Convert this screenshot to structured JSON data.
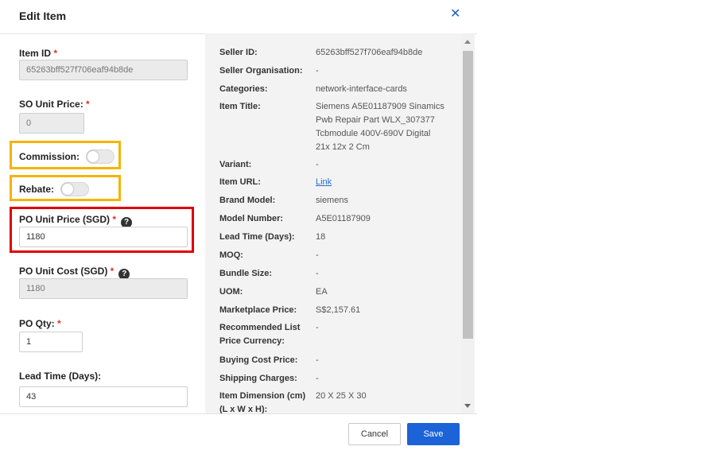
{
  "dialog": {
    "title": "Edit Item"
  },
  "form": {
    "item_id": {
      "label": "Item ID",
      "required_mark": "*",
      "value": "65263bff527f706eaf94b8de"
    },
    "so_unit_price": {
      "label": "SO Unit Price:",
      "required_mark": "*",
      "value": "0"
    },
    "commission": {
      "label": "Commission:",
      "enabled": false
    },
    "rebate": {
      "label": "Rebate:",
      "enabled": false
    },
    "po_unit_price": {
      "label": "PO Unit Price (SGD)",
      "required_mark": "*",
      "help": "?",
      "value": "1180"
    },
    "po_unit_cost": {
      "label": "PO Unit Cost (SGD)",
      "required_mark": "*",
      "help": "?",
      "value": "1180"
    },
    "po_qty": {
      "label": "PO Qty:",
      "required_mark": "*",
      "value": "1"
    },
    "lead_time": {
      "label": "Lead Time (Days):",
      "value": "43"
    }
  },
  "details": [
    {
      "label": "Seller ID:",
      "value": "65263bff527f706eaf94b8de"
    },
    {
      "label": "Seller Organisation:",
      "value": "-"
    },
    {
      "label": "Categories:",
      "value": "network-interface-cards"
    },
    {
      "label": "Item Title:",
      "value": "Siemens A5E01187909 Sinamics Pwb Repair Part WLX_307377 Tcbmodule 400V-690V Digital 21x 12x 2 Cm"
    },
    {
      "label": "Variant:",
      "value": "-"
    },
    {
      "label": "Item URL:",
      "value": "Link"
    },
    {
      "label": "Brand Model:",
      "value": "siemens"
    },
    {
      "label": "Model Number:",
      "value": "A5E01187909"
    },
    {
      "label": "Lead Time (Days):",
      "value": "18"
    },
    {
      "label": "MOQ:",
      "value": "-"
    },
    {
      "label": "Bundle Size:",
      "value": "-"
    },
    {
      "label": "UOM:",
      "value": "EA"
    },
    {
      "label": "Marketplace Price:",
      "value": "S$2,157.61"
    },
    {
      "label": "Recommended List Price Currency:",
      "value": "-"
    },
    {
      "label": "Buying Cost Price:",
      "value": "-"
    },
    {
      "label": "Shipping Charges:",
      "value": "-"
    },
    {
      "label": "Item Dimension (cm) (L x W x H):",
      "value": "20 X 25 X 30"
    }
  ],
  "footer": {
    "cancel_label": "Cancel",
    "save_label": "Save"
  },
  "colors": {
    "primary": "#1b63d6",
    "highlight_yellow": "#f5b400",
    "highlight_red": "#e00000",
    "required": "#d9342b"
  },
  "icons": {
    "close": "close-icon",
    "help": "help-icon"
  }
}
